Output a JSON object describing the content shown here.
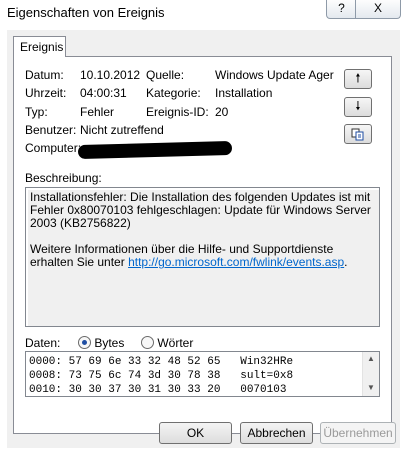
{
  "window": {
    "title": "Eigenschaften von Ereignis",
    "help_label": "?",
    "close_label": "X"
  },
  "tab": {
    "label": "Ereignis"
  },
  "fields": {
    "datum_label": "Datum:",
    "datum_value": "10.10.2012",
    "uhrzeit_label": "Uhrzeit:",
    "uhrzeit_value": "04:00:31",
    "typ_label": "Typ:",
    "typ_value": "Fehler",
    "benutzer_label": "Benutzer:",
    "benutzer_value": "Nicht zutreffend",
    "computer_label": "Computer:",
    "quelle_label": "Quelle:",
    "quelle_value": "Windows Update Ager",
    "kategorie_label": "Kategorie:",
    "kategorie_value": "Installation",
    "ereignis_id_label": "Ereignis-ID:",
    "ereignis_id_value": "20"
  },
  "nav": {
    "up_icon": "arrow-up-icon",
    "down_icon": "arrow-down-icon",
    "copy_icon": "copy-icon"
  },
  "description": {
    "label": "Beschreibung:",
    "text1": "Installationsfehler: Die Installation des folgenden Updates ist mit Fehler 0x80070103 fehlgeschlagen: Update für Windows Server 2003 (KB2756822)",
    "text2": "Weitere Informationen über die Hilfe- und Supportdienste erhalten Sie unter ",
    "link": "http://go.microsoft.com/fwlink/events.asp",
    "text2_end": "."
  },
  "data_section": {
    "label": "Daten:",
    "bytes_label": "Bytes",
    "words_label": "Wörter",
    "selected": "Bytes",
    "hex_lines": [
      "0000: 57 69 6e 33 32 48 52 65   Win32HRe",
      "0008: 73 75 6c 74 3d 30 78 38   sult=0x8",
      "0010: 30 30 37 30 31 30 33 20   0070103 "
    ]
  },
  "buttons": {
    "ok": "OK",
    "cancel": "Abbrechen",
    "apply": "Übernehmen"
  }
}
